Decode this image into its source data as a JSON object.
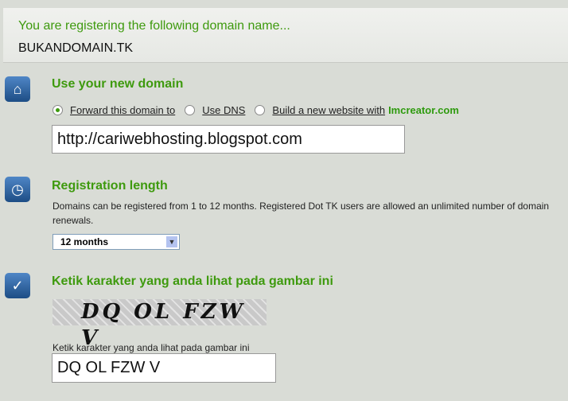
{
  "banner": {
    "title": "You are registering the following domain name...",
    "domain": "BUKANDOMAIN.TK"
  },
  "use_domain": {
    "heading": "Use your new domain",
    "options": [
      "Forward this domain to",
      "Use DNS",
      "Build a new website with"
    ],
    "brand": "Imcreator.com",
    "selected": "Forward this domain to",
    "url": "http://cariwebhosting.blogspot.com"
  },
  "length": {
    "heading": "Registration length",
    "description": "Domains can be registered from 1 to 12 months. Registered Dot TK users are allowed an unlimited number of domain renewals.",
    "selected": "12 months"
  },
  "captcha": {
    "heading": "Ketik karakter yang anda lihat pada gambar ini",
    "image_text": "DQ OL FZW V",
    "label": "Ketik karakter yang anda lihat pada gambar ini",
    "value": "DQ OL FZW V"
  }
}
